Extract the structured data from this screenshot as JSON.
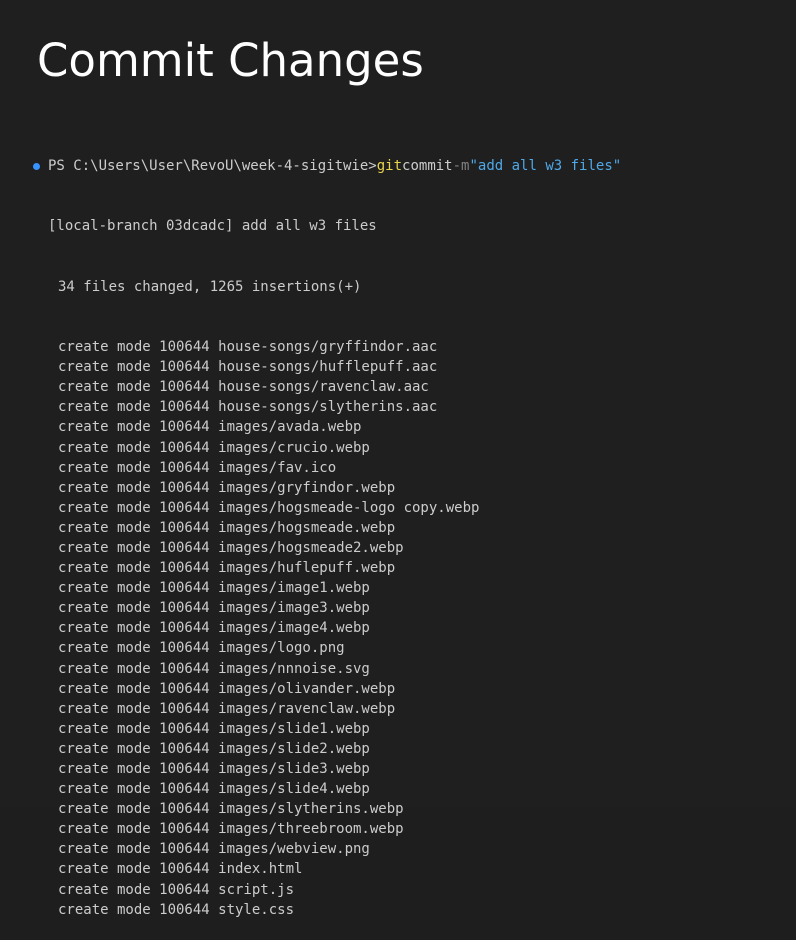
{
  "title": "Commit Changes",
  "terminal": {
    "prompt": "PS C:\\Users\\User\\RevoU\\week-4-sigitwie>",
    "command": "git",
    "subcommand": "commit",
    "flag": "-m",
    "message": "\"add all w3 files\"",
    "branch_line": "[local-branch 03dcadc] add all w3 files",
    "summary_line": "34 files changed, 1265 insertions(+)",
    "create_lines": [
      "create mode 100644 house-songs/gryffindor.aac",
      "create mode 100644 house-songs/hufflepuff.aac",
      "create mode 100644 house-songs/ravenclaw.aac",
      "create mode 100644 house-songs/slytherins.aac",
      "create mode 100644 images/avada.webp",
      "create mode 100644 images/crucio.webp",
      "create mode 100644 images/fav.ico",
      "create mode 100644 images/gryfindor.webp",
      "create mode 100644 images/hogsmeade-logo copy.webp",
      "create mode 100644 images/hogsmeade.webp",
      "create mode 100644 images/hogsmeade2.webp",
      "create mode 100644 images/huflepuff.webp",
      "create mode 100644 images/image1.webp",
      "create mode 100644 images/image3.webp",
      "create mode 100644 images/image4.webp",
      "create mode 100644 images/logo.png",
      "create mode 100644 images/nnnoise.svg",
      "create mode 100644 images/olivander.webp",
      "create mode 100644 images/ravenclaw.webp",
      "create mode 100644 images/slide1.webp",
      "create mode 100644 images/slide2.webp",
      "create mode 100644 images/slide3.webp",
      "create mode 100644 images/slide4.webp",
      "create mode 100644 images/slytherins.webp",
      "create mode 100644 images/threebroom.webp",
      "create mode 100644 images/webview.png",
      "create mode 100644 index.html",
      "create mode 100644 script.js",
      "create mode 100644 style.css"
    ]
  },
  "colors": {
    "background": "#1f1f1f",
    "prompt_dot": "#3794ff",
    "command": "#e8d44d",
    "string": "#4fa8e8",
    "text": "#cccccc"
  }
}
